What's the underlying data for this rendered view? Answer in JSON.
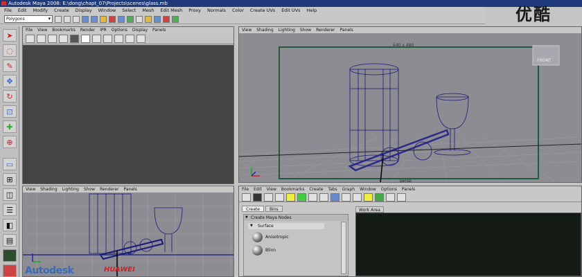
{
  "window": {
    "title": "Autodesk Maya 2008:  E:\\dong\\chapt_07\\Projects\\scenes\\glass.mb"
  },
  "watermark": "优酷",
  "menubar": [
    "File",
    "Edit",
    "Modify",
    "Create",
    "Display",
    "Window",
    "Select",
    "Mesh",
    "Edit Mesh",
    "Proxy",
    "Normals",
    "Color",
    "Create UVs",
    "Edit UVs",
    "Help"
  ],
  "statusline": {
    "mode": "Polygons"
  },
  "hypershade_panel": {
    "menu": [
      "File",
      "View",
      "Bookmarks",
      "Render",
      "IPR",
      "Options",
      "Display",
      "Panels"
    ]
  },
  "persp_panel": {
    "menu": [
      "View",
      "Shading",
      "Lighting",
      "Show",
      "Renderer",
      "Panels"
    ],
    "resolution": "640 x 480",
    "view_cube": "FRONT",
    "camera": "persp"
  },
  "side_panel": {
    "menu": [
      "View",
      "Shading",
      "Lighting",
      "Show",
      "Renderer",
      "Panels"
    ]
  },
  "hypershade": {
    "menu": [
      "File",
      "Edit",
      "View",
      "Bookmarks",
      "Create",
      "Tabs",
      "Graph",
      "Window",
      "Options",
      "Panels"
    ],
    "tabs": [
      "Create",
      "Bins"
    ],
    "create_header": "Create Maya Nodes",
    "section": "Surface",
    "nodes": [
      "Anisotropic",
      "Blinn"
    ],
    "work_area": "Work Area"
  },
  "logos": {
    "autodesk": "Autodesk",
    "brand": "HUAWEI"
  }
}
